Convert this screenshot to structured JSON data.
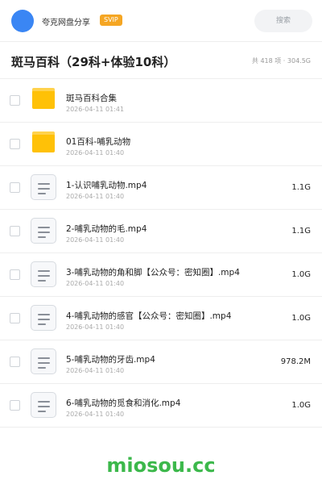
{
  "header": {
    "share_name": "夸克网盘分享",
    "badge": "SVIP",
    "search_placeholder": "搜索"
  },
  "folder": {
    "title": "斑马百科（29科+体验10科）",
    "summary": "共 418 项 · 304.5G"
  },
  "files": [
    {
      "type": "folder",
      "name": "斑马百科合集",
      "date": "2026-04-11 01:41",
      "size": ""
    },
    {
      "type": "folder",
      "name": "01百科-哺乳动物",
      "date": "2026-04-11 01:40",
      "size": ""
    },
    {
      "type": "video",
      "name": "1-认识哺乳动物.mp4",
      "date": "2026-04-11 01:40",
      "size": "1.1G"
    },
    {
      "type": "video",
      "name": "2-哺乳动物的毛.mp4",
      "date": "2026-04-11 01:40",
      "size": "1.1G"
    },
    {
      "type": "video",
      "name": "3-哺乳动物的角和脚【公众号：密知圈】.mp4",
      "date": "2026-04-11 01:40",
      "size": "1.0G"
    },
    {
      "type": "video",
      "name": "4-哺乳动物的感官【公众号：密知圈】.mp4",
      "date": "2026-04-11 01:40",
      "size": "1.0G"
    },
    {
      "type": "video",
      "name": "5-哺乳动物的牙齿.mp4",
      "date": "2026-04-11 01:40",
      "size": "978.2M"
    },
    {
      "type": "video",
      "name": "6-哺乳动物的觅食和消化.mp4",
      "date": "2026-04-11 01:40",
      "size": "1.0G"
    }
  ],
  "watermark": "miosou.cc",
  "colors": {
    "accent": "#3a86f4",
    "folder": "#ffc107",
    "badge": "#f5a623",
    "watermark": "#3cb84b"
  }
}
